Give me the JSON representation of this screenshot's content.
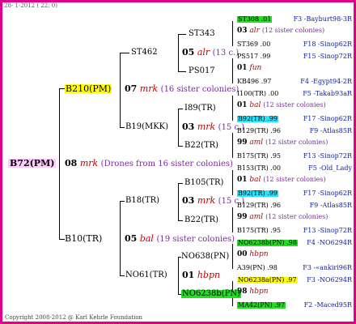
{
  "header": "28- 1-2012 ( 22: 0)",
  "footer": "Copyright 2008-2012 @ Karl Kehrle Foundation",
  "root": {
    "id": "B72(PM)"
  },
  "gen1": {
    "num": "08",
    "code": "mrk",
    "note": "(Drones from 16 sister colonies)"
  },
  "queens": {
    "p1": {
      "id": "B210(PM)",
      "num": "07",
      "code": "mrk",
      "note": "(16 sister colonies)"
    },
    "p2": {
      "id": "B10(TR)",
      "num": "05",
      "code": "bal",
      "note": "(19 sister colonies)"
    },
    "p11": {
      "id": "ST462",
      "num": "05",
      "code": "alr",
      "note": "(13 c.)"
    },
    "p12": {
      "id": "B19(MKK)",
      "num": "03",
      "code": "mrk",
      "note": "(15 c.)"
    },
    "p21": {
      "id": "B18(TR)",
      "num": "03",
      "code": "mrk",
      "note": "(15 c.)"
    },
    "p22": {
      "id": "NO61(TR)",
      "num": "01",
      "code": "hbpn"
    },
    "p111": "ST343",
    "p112": "PS017",
    "p121": "I89(TR)",
    "p122": "B22(TR)",
    "p211": "B105(TR)",
    "p212": "B22(TR)",
    "p221": "NO638(PN)",
    "p222": "NO6238b(PN)"
  },
  "right": [
    {
      "id": "ST308 .01",
      "src": "F3 -Bayburt98-3R",
      "hl": "g"
    },
    {
      "num": "03",
      "code": "alr",
      "note": "(12 sister colonies)"
    },
    {
      "id": "ST369 .00",
      "src": "F18 -Sinop62R"
    },
    {
      "id": "PS517 .99",
      "src": "F15 -Sinop72R"
    },
    {
      "num": "01",
      "code": "fun"
    },
    {
      "id": "KB496 .97",
      "src": "F4 -Egypt94-2R"
    },
    {
      "id": "I100(TR) .00",
      "src": "F5 -Takab93aR"
    },
    {
      "num": "01",
      "code": "bal",
      "note": "(12 sister colonies)"
    },
    {
      "id": "B92(TR) .99",
      "src": "F17 -Sinop62R",
      "hl": "c"
    },
    {
      "id": "B129(TR) .96",
      "src": "F9 -Atlas85R"
    },
    {
      "num": "99",
      "code": "aml",
      "note": "(12 sister colonies)"
    },
    {
      "id": "B175(TR) .95",
      "src": "F13 -Sinop72R"
    },
    {
      "id": "B153(TR) .00",
      "src": "F5 -Old_Lady"
    },
    {
      "num": "01",
      "code": "bal",
      "note": "(12 sister colonies)"
    },
    {
      "id": "B92(TR) .99",
      "src": "F17 -Sinop62R",
      "hl": "c"
    },
    {
      "id": "B129(TR) .96",
      "src": "F9 -Atlas85R"
    },
    {
      "num": "99",
      "code": "aml",
      "note": "(12 sister colonies)"
    },
    {
      "id": "B175(TR) .95",
      "src": "F13 -Sinop72R"
    },
    {
      "id": "NO6238b(PN) .98",
      "src": "F4 -NO6294R",
      "hl": "g"
    },
    {
      "num": "00",
      "code": "hbpn"
    },
    {
      "id": "A39(PN) .98",
      "src": "F3 -«ankiri96R"
    },
    {
      "id": "NO6238a(PN) .97",
      "src": "F3 -NO6294R",
      "hl": "y"
    },
    {
      "num": "98",
      "code": "hbpn"
    },
    {
      "id": "MA42(PN) .97",
      "src": "F2 -Maced95R",
      "hl": "g"
    }
  ]
}
